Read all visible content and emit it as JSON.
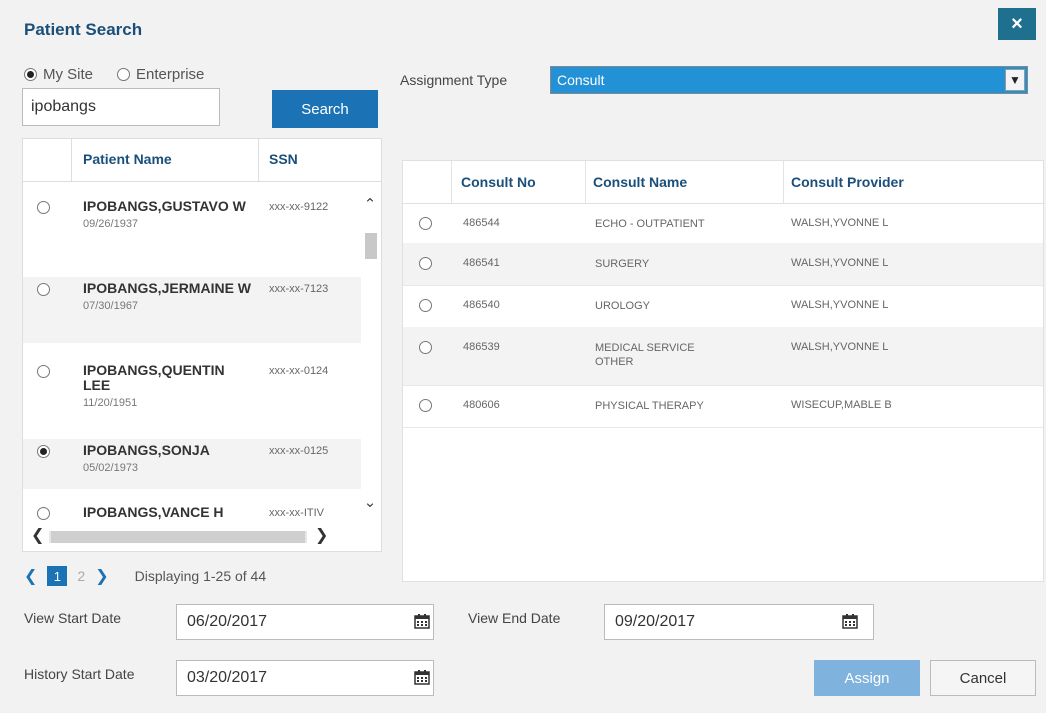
{
  "dialog": {
    "title": "Patient Search",
    "close_label": "×"
  },
  "scope": {
    "my_site": "My Site",
    "enterprise": "Enterprise",
    "selected": "My Site"
  },
  "search": {
    "value": "ipobangs",
    "button": "Search"
  },
  "patients": {
    "headers": {
      "name": "Patient Name",
      "ssn": "SSN"
    },
    "rows": [
      {
        "name": "IPOBANGS,GUSTAVO W",
        "dob": "09/26/1937",
        "ssn": "xxx-xx-9122",
        "selected": false
      },
      {
        "name": "IPOBANGS,JERMAINE W",
        "dob": "07/30/1967",
        "ssn": "xxx-xx-7123",
        "selected": false
      },
      {
        "name": "IPOBANGS,QUENTIN LEE",
        "dob": "11/20/1951",
        "ssn": "xxx-xx-0124",
        "selected": false
      },
      {
        "name": "IPOBANGS,SONJA",
        "dob": "05/02/1973",
        "ssn": "xxx-xx-0125",
        "selected": true
      },
      {
        "name": "IPOBANGS,VANCE H",
        "dob": "",
        "ssn": "xxx-xx-ITIV",
        "selected": false
      }
    ]
  },
  "pager": {
    "current": "1",
    "next_page": "2",
    "status": "Displaying 1-25 of 44"
  },
  "assignment": {
    "label": "Assignment Type",
    "value": "Consult"
  },
  "consults": {
    "headers": {
      "no": "Consult No",
      "name": "Consult Name",
      "provider": "Consult Provider"
    },
    "rows": [
      {
        "no": "486544",
        "name": "ECHO - OUTPATIENT",
        "provider": "WALSH,YVONNE L"
      },
      {
        "no": "486541",
        "name": "SURGERY",
        "provider": "WALSH,YVONNE L"
      },
      {
        "no": "486540",
        "name": "UROLOGY",
        "provider": "WALSH,YVONNE L"
      },
      {
        "no": "486539",
        "name": "MEDICAL SERVICE OTHER",
        "provider": "WALSH,YVONNE L"
      },
      {
        "no": "480606",
        "name": "PHYSICAL THERAPY",
        "provider": "WISECUP,MABLE B"
      }
    ]
  },
  "dates": {
    "view_start_label": "View Start Date",
    "view_start": "06/20/2017",
    "view_end_label": "View End Date",
    "view_end": "09/20/2017",
    "history_start_label": "History Start Date",
    "history_start": "03/20/2017"
  },
  "actions": {
    "assign": "Assign",
    "cancel": "Cancel"
  },
  "colors": {
    "accent": "#1b73b5",
    "select_bg": "#2391d6",
    "close_bg": "#1f6f8f",
    "assign_disabled": "#7fb2dc"
  }
}
